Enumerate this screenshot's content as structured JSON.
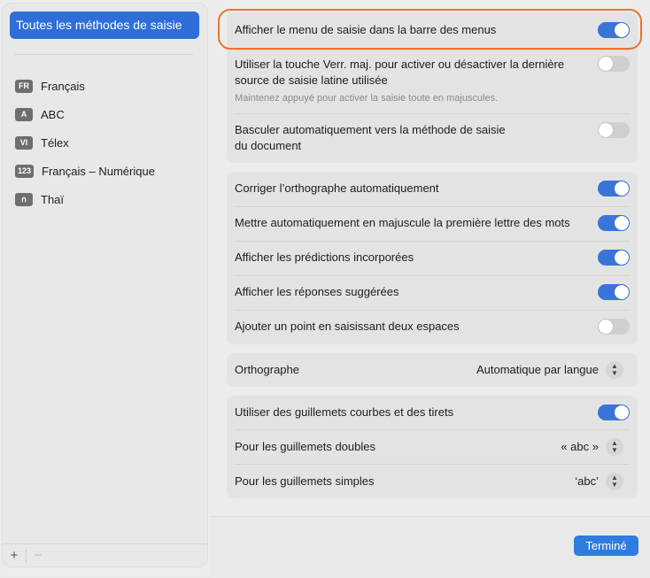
{
  "sidebar": {
    "selected_label": "Toutes les méthodes de saisie",
    "items": [
      {
        "badge": "FR",
        "label": "Français"
      },
      {
        "badge": "A",
        "label": "ABC"
      },
      {
        "badge": "VI",
        "label": "Télex"
      },
      {
        "badge": "123",
        "label": "Français – Numérique"
      },
      {
        "badge": "ก",
        "label": "Thaï"
      }
    ],
    "footer": {
      "add": "+",
      "remove": "−"
    }
  },
  "settings": {
    "group1": {
      "row1": {
        "label": "Afficher le menu de saisie dans la barre des menus",
        "toggle": "on"
      },
      "row2": {
        "label_line1": "Utiliser la touche Verr. maj. pour activer ou désactiver la dernière",
        "label_line2": "source de saisie latine utilisée",
        "subtext": "Maintenez appuyé pour activer la saisie toute en majuscules.",
        "toggle": "off"
      },
      "row3": {
        "label_line1": "Basculer automatiquement vers la méthode de saisie",
        "label_line2": "du document",
        "toggle": "off"
      }
    },
    "group2": {
      "row1": {
        "label": "Corriger l’orthographe automatiquement",
        "toggle": "on"
      },
      "row2": {
        "label": "Mettre automatiquement en majuscule la première lettre des mots",
        "toggle": "on"
      },
      "row3": {
        "label": "Afficher les prédictions incorporées",
        "toggle": "on"
      },
      "row4": {
        "label": "Afficher les réponses suggérées",
        "toggle": "on"
      },
      "row5": {
        "label": "Ajouter un point en saisissant deux espaces",
        "toggle": "off"
      }
    },
    "group3": {
      "row1": {
        "label": "Orthographe",
        "value": "Automatique par langue"
      }
    },
    "group4": {
      "row1": {
        "label": "Utiliser des guillemets courbes et des tirets",
        "toggle": "on"
      },
      "row2": {
        "label": "Pour les guillemets doubles",
        "value": "« abc »"
      },
      "row3": {
        "label": "Pour les guillemets simples",
        "value": "‘abc’"
      }
    }
  },
  "footer": {
    "done_label": "Terminé"
  },
  "colors": {
    "accent": "#2f6ed6",
    "toggle_on": "#3b74d9",
    "highlight": "#e8722f"
  }
}
